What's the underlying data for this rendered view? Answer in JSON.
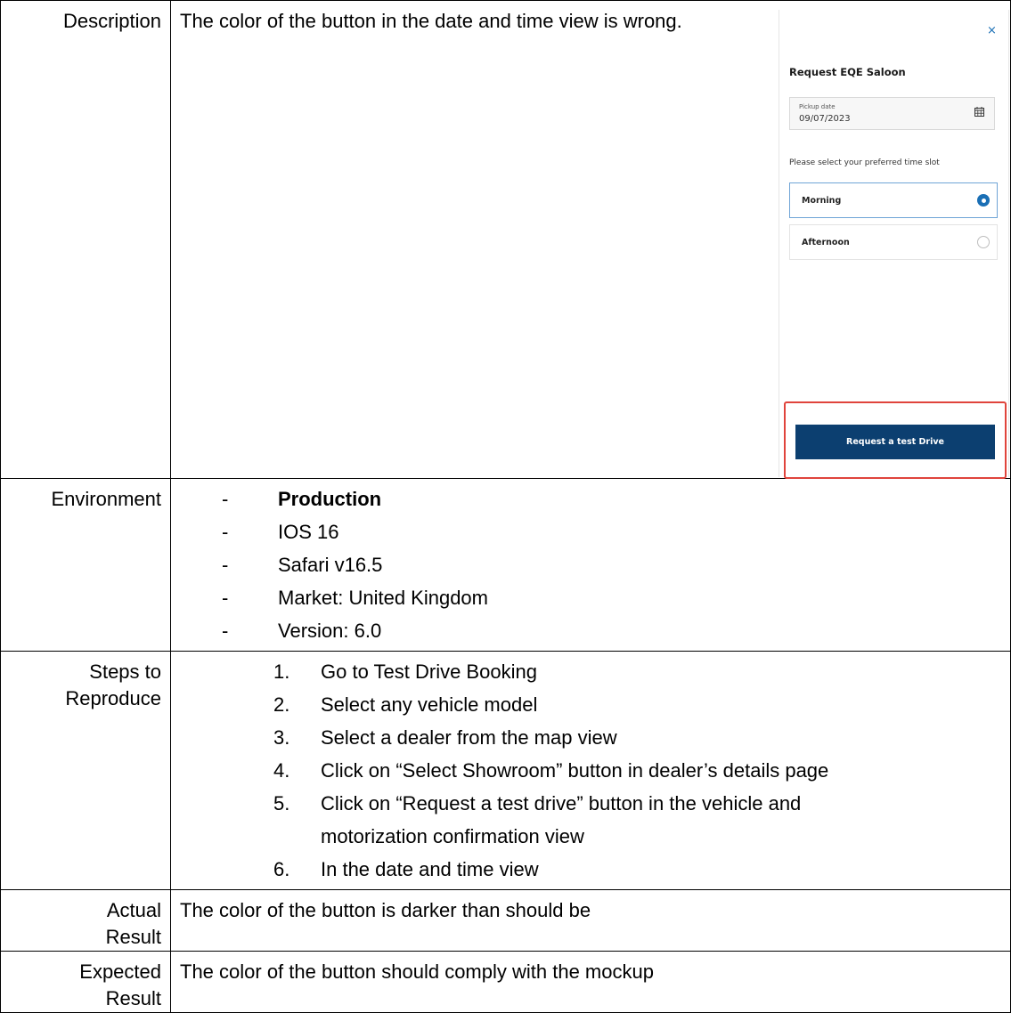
{
  "rows": {
    "description": {
      "label": "Description",
      "text": "The color of the button in the date and time view is wrong."
    },
    "environment": {
      "label": "Environment",
      "items": [
        "Production",
        "IOS 16",
        "Safari v16.5",
        "Market: United Kingdom",
        "Version: 6.0"
      ]
    },
    "steps": {
      "label_line1": "Steps to",
      "label_line2": "Reproduce",
      "items": [
        {
          "num": "1.",
          "lines": [
            "Go to Test Drive Booking"
          ]
        },
        {
          "num": "2.",
          "lines": [
            "Select any vehicle model"
          ]
        },
        {
          "num": "3.",
          "lines": [
            "Select a dealer from the map view"
          ]
        },
        {
          "num": "4.",
          "lines": [
            "Click on “Select Showroom” button in dealer’s details page"
          ]
        },
        {
          "num": "5.",
          "lines": [
            "Click on “Request a test drive” button in the vehicle and",
            "motorization confirmation view"
          ]
        },
        {
          "num": "6.",
          "lines": [
            "In the date and time view"
          ]
        }
      ]
    },
    "actual": {
      "label_line1": "Actual",
      "label_line2": "Result",
      "text": "The color of the button is darker than should be"
    },
    "expected": {
      "label_line1": "Expected",
      "label_line2": "Result",
      "text": "The color of the button should comply with the mockup"
    }
  },
  "mockup": {
    "close_glyph": "×",
    "title": "Request EQE Saloon",
    "date_label": "Pickup date",
    "date_value": "09/07/2023",
    "calendar_icon": "calendar-icon",
    "slot_prompt": "Please select your preferred time slot",
    "slots": [
      {
        "label": "Morning",
        "selected": true
      },
      {
        "label": "Afternoon",
        "selected": false
      }
    ],
    "cta_label": "Request a test Drive",
    "colors": {
      "accent": "#1a6fb5",
      "cta_background": "#0c3f70",
      "highlight": "#e0443c"
    }
  }
}
